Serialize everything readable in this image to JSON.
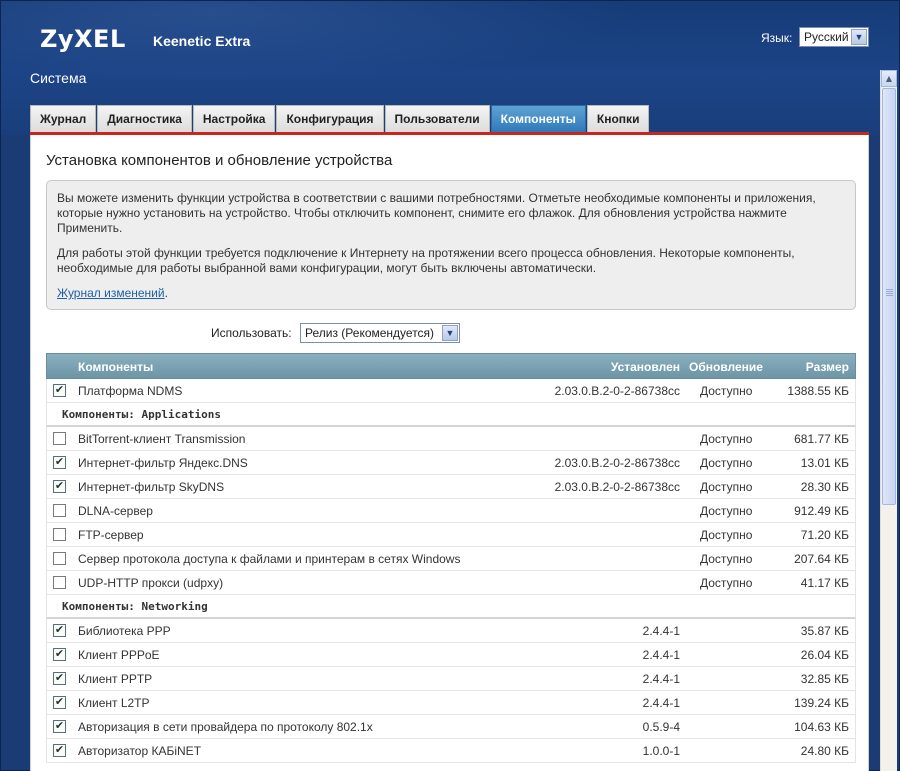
{
  "brand": {
    "logo": "ZyXEL",
    "product": "Keenetic Extra"
  },
  "language": {
    "label": "Язык:",
    "selected": "Русский"
  },
  "page_title": "Система",
  "tabs": [
    {
      "label": "Журнал",
      "active": false
    },
    {
      "label": "Диагностика",
      "active": false
    },
    {
      "label": "Настройка",
      "active": false
    },
    {
      "label": "Конфигурация",
      "active": false
    },
    {
      "label": "Пользователи",
      "active": false
    },
    {
      "label": "Компоненты",
      "active": true
    },
    {
      "label": "Кнопки",
      "active": false
    }
  ],
  "section_title": "Установка компонентов и обновление устройства",
  "info": {
    "p1": "Вы можете изменить функции устройства в соответствии с вашими потребностями. Отметьте необходимые компоненты и приложения, которые нужно установить на устройство. Чтобы отключить компонент, снимите его флажок. Для обновления устройства нажмите Применить.",
    "p2": "Для работы этой функции требуется подключение к Интернету на протяжении всего процесса обновления. Некоторые компоненты, необходимые для работы выбранной вами конфигурации, могут быть включены автоматически.",
    "changelog_link": "Журнал изменений",
    "changelog_suffix": "."
  },
  "use": {
    "label": "Использовать:",
    "selected": "Релиз (Рекомендуется)"
  },
  "table": {
    "headers": {
      "components": "Компоненты",
      "installed": "Установлен",
      "update": "Обновление",
      "size": "Размер"
    },
    "platform": {
      "checked": true,
      "name": "Платформа NDMS",
      "installed": "2.03.0.B.2-0-2-86738cc",
      "update": "Доступно",
      "size": "1388.55 КБ"
    },
    "groups": [
      {
        "title": "Компоненты: Applications",
        "rows": [
          {
            "checked": false,
            "name": "BitTorrent-клиент Transmission",
            "installed": "",
            "update": "Доступно",
            "size": "681.77 КБ"
          },
          {
            "checked": true,
            "name": "Интернет-фильтр Яндекс.DNS",
            "installed": "2.03.0.B.2-0-2-86738cc",
            "update": "Доступно",
            "size": "13.01 КБ"
          },
          {
            "checked": true,
            "name": "Интернет-фильтр SkyDNS",
            "installed": "2.03.0.B.2-0-2-86738cc",
            "update": "Доступно",
            "size": "28.30 КБ"
          },
          {
            "checked": false,
            "name": "DLNA-сервер",
            "installed": "",
            "update": "Доступно",
            "size": "912.49 КБ"
          },
          {
            "checked": false,
            "name": "FTP-сервер",
            "installed": "",
            "update": "Доступно",
            "size": "71.20 КБ"
          },
          {
            "checked": false,
            "name": "Сервер протокола доступа к файлами и принтерам в сетях Windows",
            "installed": "",
            "update": "Доступно",
            "size": "207.64 КБ"
          },
          {
            "checked": false,
            "name": "UDP-HTTP прокси (udpxy)",
            "installed": "",
            "update": "Доступно",
            "size": "41.17 КБ"
          }
        ]
      },
      {
        "title": "Компоненты: Networking",
        "rows": [
          {
            "checked": true,
            "name": "Библиотека PPP",
            "installed": "2.4.4-1",
            "update": "",
            "size": "35.87 КБ"
          },
          {
            "checked": true,
            "name": "Клиент PPPoE",
            "installed": "2.4.4-1",
            "update": "",
            "size": "26.04 КБ"
          },
          {
            "checked": true,
            "name": "Клиент PPTP",
            "installed": "2.4.4-1",
            "update": "",
            "size": "32.85 КБ"
          },
          {
            "checked": true,
            "name": "Клиент L2TP",
            "installed": "2.4.4-1",
            "update": "",
            "size": "139.24 КБ"
          },
          {
            "checked": true,
            "name": "Авторизация в сети провайдера по протоколу 802.1x",
            "installed": "0.5.9-4",
            "update": "",
            "size": "104.63 КБ"
          },
          {
            "checked": true,
            "name": "Авторизатор КАБiNET",
            "installed": "1.0.0-1",
            "update": "",
            "size": "24.80 КБ"
          }
        ]
      }
    ]
  },
  "icons": {
    "dropdown": "chevron-down-icon",
    "check": "checkmark-icon",
    "scroll_up": "arrow-up-icon"
  },
  "colors": {
    "header_bg": "#1a3e7c",
    "active_tab": "#2f79b8",
    "accent_line": "#c8261f",
    "table_head": "#7aa2b2"
  }
}
